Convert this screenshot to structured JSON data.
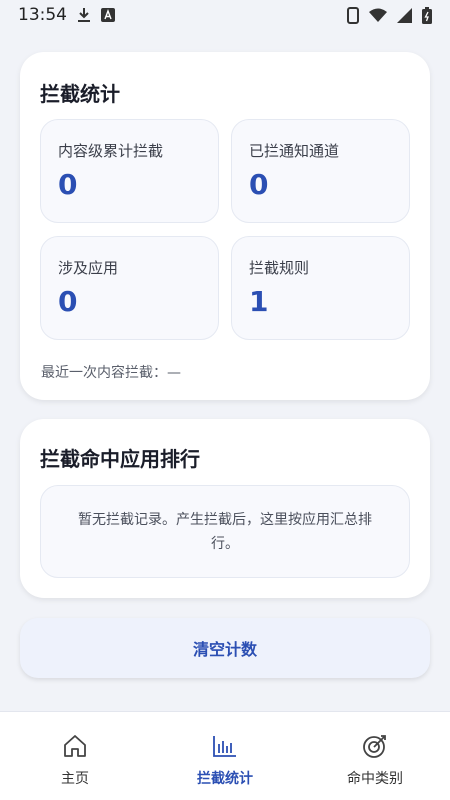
{
  "status_bar": {
    "time": "13:54"
  },
  "stats_card": {
    "title": "拦截统计",
    "items": [
      {
        "label": "内容级累计拦截",
        "value": "0"
      },
      {
        "label": "已拦通知通道",
        "value": "0"
      },
      {
        "label": "涉及应用",
        "value": "0"
      },
      {
        "label": "拦截规则",
        "value": "1"
      }
    ],
    "last_intercept": "最近一次内容拦截：—"
  },
  "ranking_card": {
    "title": "拦截命中应用排行",
    "empty_text": "暂无拦截记录。产生拦截后，这里按应用汇总排行。"
  },
  "clear_button": {
    "label": "清空计数"
  },
  "bottom_nav": {
    "items": [
      {
        "label": "主页",
        "icon": "home-icon",
        "active": false
      },
      {
        "label": "拦截统计",
        "icon": "bar-chart-icon",
        "active": true
      },
      {
        "label": "命中类别",
        "icon": "target-icon",
        "active": false
      }
    ]
  },
  "colors": {
    "accent": "#2b4fb3",
    "background": "#f1f3f8",
    "card": "#ffffff"
  }
}
